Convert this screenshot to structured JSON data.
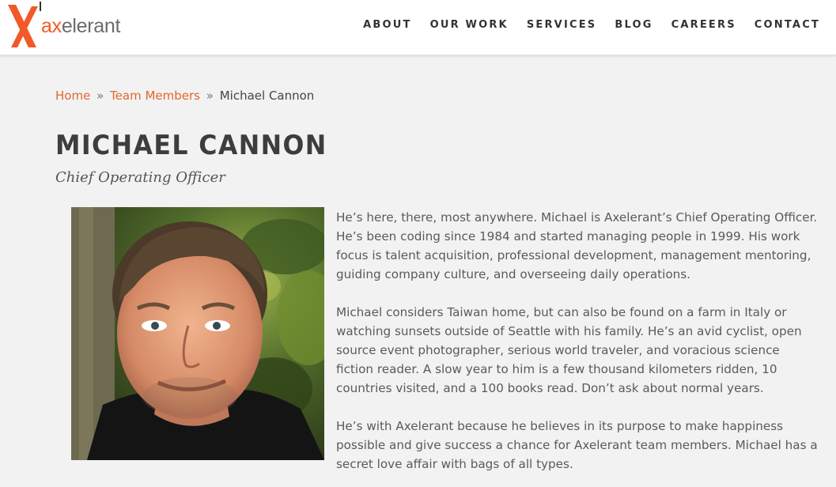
{
  "site": {
    "logo_text_accent": "ax",
    "logo_text_rest": "elerant",
    "logo_colors": {
      "orange": "#f05a28",
      "grey": "#6b6b6b"
    },
    "nav": [
      {
        "label": "ABOUT"
      },
      {
        "label": "OUR WORK"
      },
      {
        "label": "SERVICES"
      },
      {
        "label": "BLOG"
      },
      {
        "label": "CAREERS"
      },
      {
        "label": "CONTACT"
      }
    ]
  },
  "breadcrumb": {
    "home": "Home",
    "sep": "»",
    "team": "Team Members",
    "current": "Michael Cannon"
  },
  "profile": {
    "name": "MICHAEL CANNON",
    "role": "Chief Operating Officer",
    "photo_icon": "portrait-photo",
    "bio": [
      "He’s here, there, most anywhere. Michael is Axelerant’s Chief Operating Officer. He’s been coding since 1984 and started managing people in 1999. His work focus is talent acquisition, professional development, management mentoring, guiding company culture, and overseeing daily operations.",
      "Michael considers Taiwan home, but can also be found on a farm in Italy or watching sunsets outside of Seattle with his family. He’s an avid cyclist, open source event photographer, serious world traveler, and voracious science fiction reader. A slow year to him is a few thousand kilometers ridden, 10 countries visited, and a 100 books read. Don’t ask about normal years.",
      "He’s with Axelerant because he believes in its purpose to make happiness possible and give success a chance for Axelerant team members. Michael has a secret love affair with bags of all types."
    ]
  },
  "colors": {
    "accent": "#e0692e",
    "background": "#f2f2f2",
    "heading": "#3d3d3d"
  }
}
